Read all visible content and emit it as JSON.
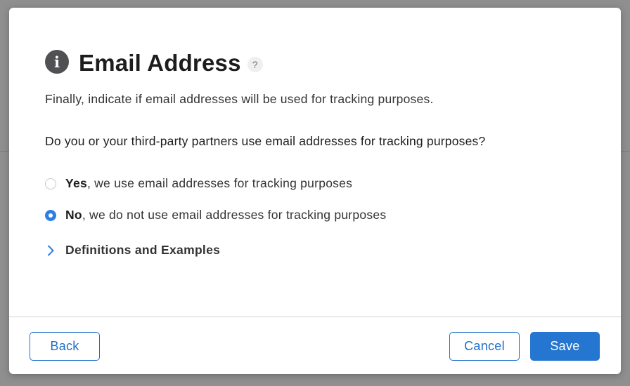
{
  "dialog": {
    "title": "Email Address",
    "help_glyph": "?",
    "info_glyph": "i",
    "intro": "Finally, indicate if email addresses will be used for tracking purposes.",
    "question": "Do you or your third-party partners use email addresses for tracking purposes?",
    "options": [
      {
        "label_bold": "Yes",
        "label_rest": ", we use email addresses for tracking purposes",
        "selected": false
      },
      {
        "label_bold": "No",
        "label_rest": ", we do not use email addresses for tracking purposes",
        "selected": true
      }
    ],
    "disclosure": {
      "label": "Definitions and Examples",
      "icon": "chevron-right-icon"
    }
  },
  "footer": {
    "back_label": "Back",
    "cancel_label": "Cancel",
    "save_label": "Save"
  },
  "colors": {
    "accent": "#2476d0",
    "radio_selected": "#2f7ee6",
    "info_icon": "#515154"
  }
}
